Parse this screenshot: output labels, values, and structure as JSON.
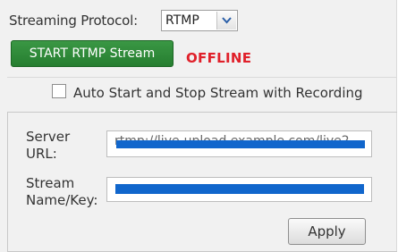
{
  "protocol": {
    "label": "Streaming Protocol:",
    "selected": "RTMP"
  },
  "stream_control": {
    "start_label": "START RTMP Stream",
    "status": "OFFLINE",
    "status_color": "#e0202a",
    "button_color": "#2e8b38"
  },
  "auto_start": {
    "label": "Auto Start and Stop Stream with Recording",
    "checked": false
  },
  "server": {
    "label_line1": "Server",
    "label_line2": "URL:",
    "value": "rtmp://live-upload.example.com/live2"
  },
  "stream_key": {
    "label_line1": "Stream",
    "label_line2": "Name/Key:",
    "value": ""
  },
  "actions": {
    "apply_label": "Apply"
  },
  "colors": {
    "redaction": "#1166cc",
    "panel_background": "#f1f1f1"
  }
}
